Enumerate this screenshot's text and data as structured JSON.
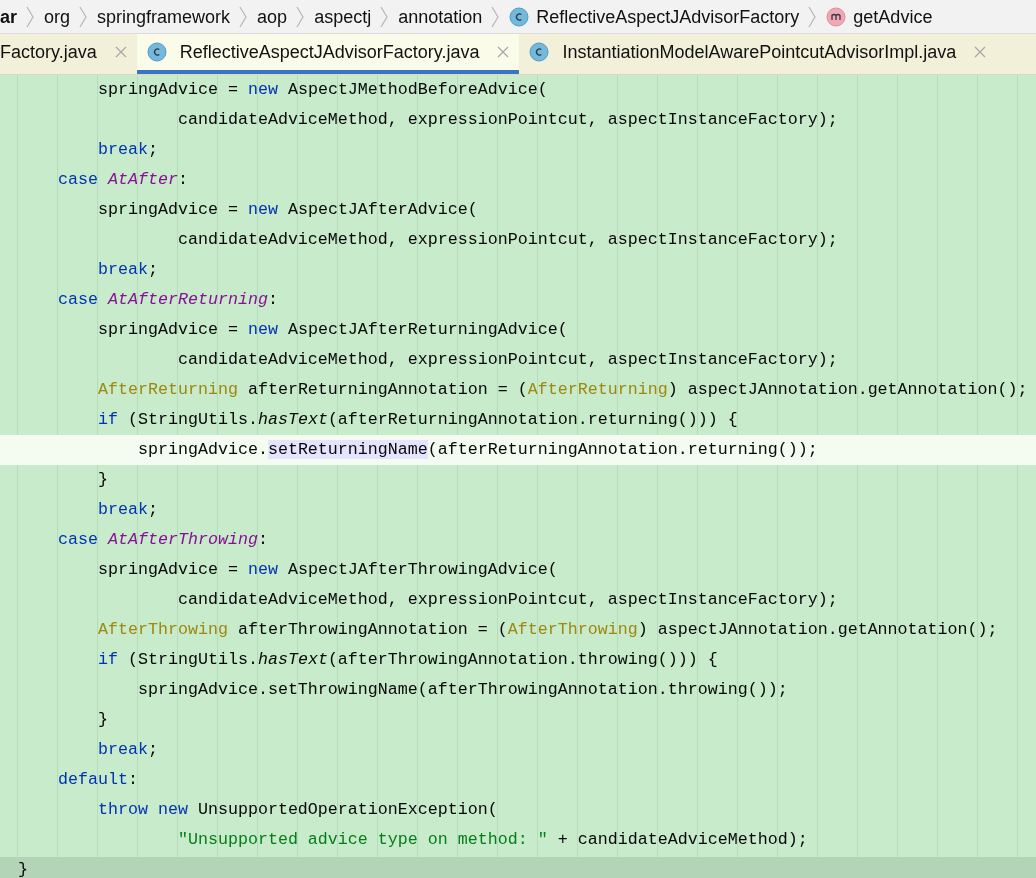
{
  "breadcrumb": [
    {
      "text": "ar",
      "kind": "package",
      "bold": true
    },
    {
      "text": "org",
      "kind": "package",
      "bold": false
    },
    {
      "text": "springframework",
      "kind": "package",
      "bold": false
    },
    {
      "text": "aop",
      "kind": "package",
      "bold": false
    },
    {
      "text": "aspectj",
      "kind": "package",
      "bold": false
    },
    {
      "text": "annotation",
      "kind": "package",
      "bold": false
    },
    {
      "text": "ReflectiveAspectJAdvisorFactory",
      "kind": "class",
      "bold": false
    },
    {
      "text": "getAdvice",
      "kind": "method",
      "bold": false
    }
  ],
  "tabs": [
    {
      "label": "Factory.java",
      "kind": "file",
      "selected": false
    },
    {
      "label": "ReflectiveAspectJAdvisorFactory.java",
      "kind": "class",
      "selected": true
    },
    {
      "label": "InstantiationModelAwarePointcutAdvisorImpl.java",
      "kind": "class",
      "selected": false
    }
  ],
  "code_lines": [
    {
      "current": false,
      "tokens": [
        {
          "kind": "plain",
          "text": "        springAdvice = "
        },
        {
          "kind": "keyword",
          "text": "new"
        },
        {
          "kind": "plain",
          "text": " AspectJMethodBeforeAdvice("
        }
      ]
    },
    {
      "current": false,
      "tokens": [
        {
          "kind": "plain",
          "text": "                candidateAdviceMethod, expressionPointcut, aspectInstanceFactory);"
        }
      ]
    },
    {
      "current": false,
      "tokens": [
        {
          "kind": "keyword",
          "text": "        break"
        },
        {
          "kind": "plain",
          "text": ";"
        }
      ]
    },
    {
      "current": false,
      "tokens": [
        {
          "kind": "keyword",
          "text": "    case"
        },
        {
          "kind": "constant",
          "text": " AtAfter"
        },
        {
          "kind": "plain",
          "text": ":"
        }
      ]
    },
    {
      "current": false,
      "tokens": [
        {
          "kind": "plain",
          "text": "        springAdvice = "
        },
        {
          "kind": "keyword",
          "text": "new"
        },
        {
          "kind": "plain",
          "text": " AspectJAfterAdvice("
        }
      ]
    },
    {
      "current": false,
      "tokens": [
        {
          "kind": "plain",
          "text": "                candidateAdviceMethod, expressionPointcut, aspectInstanceFactory);"
        }
      ]
    },
    {
      "current": false,
      "tokens": [
        {
          "kind": "keyword",
          "text": "        break"
        },
        {
          "kind": "plain",
          "text": ";"
        }
      ]
    },
    {
      "current": false,
      "tokens": [
        {
          "kind": "keyword",
          "text": "    case"
        },
        {
          "kind": "constant",
          "text": " AtAfterReturning"
        },
        {
          "kind": "plain",
          "text": ":"
        }
      ]
    },
    {
      "current": false,
      "tokens": [
        {
          "kind": "plain",
          "text": "        springAdvice = "
        },
        {
          "kind": "keyword",
          "text": "new"
        },
        {
          "kind": "plain",
          "text": " AspectJAfterReturningAdvice("
        }
      ]
    },
    {
      "current": false,
      "tokens": [
        {
          "kind": "plain",
          "text": "                candidateAdviceMethod, expressionPointcut, aspectInstanceFactory);"
        }
      ]
    },
    {
      "current": false,
      "tokens": [
        {
          "kind": "annotation",
          "text": "        AfterReturning"
        },
        {
          "kind": "plain",
          "text": " afterReturningAnnotation = ("
        },
        {
          "kind": "annotation",
          "text": "AfterReturning"
        },
        {
          "kind": "plain",
          "text": ") aspectJAnnotation.getAnnotation();"
        }
      ]
    },
    {
      "current": false,
      "tokens": [
        {
          "kind": "keyword",
          "text": "        if"
        },
        {
          "kind": "plain",
          "text": " (StringUtils."
        },
        {
          "kind": "static",
          "text": "hasText"
        },
        {
          "kind": "plain",
          "text": "(afterReturningAnnotation.returning())) {"
        }
      ]
    },
    {
      "current": true,
      "tokens": [
        {
          "kind": "plain",
          "text": "            springAdvice."
        },
        {
          "kind": "usage",
          "text": "setReturningName"
        },
        {
          "kind": "plain",
          "text": "(afterReturningAnnotation.returning());"
        }
      ]
    },
    {
      "current": false,
      "tokens": [
        {
          "kind": "plain",
          "text": "        }"
        }
      ]
    },
    {
      "current": false,
      "tokens": [
        {
          "kind": "keyword",
          "text": "        break"
        },
        {
          "kind": "plain",
          "text": ";"
        }
      ]
    },
    {
      "current": false,
      "tokens": [
        {
          "kind": "keyword",
          "text": "    case"
        },
        {
          "kind": "constant",
          "text": " AtAfterThrowing"
        },
        {
          "kind": "plain",
          "text": ":"
        }
      ]
    },
    {
      "current": false,
      "tokens": [
        {
          "kind": "plain",
          "text": "        springAdvice = "
        },
        {
          "kind": "keyword",
          "text": "new"
        },
        {
          "kind": "plain",
          "text": " AspectJAfterThrowingAdvice("
        }
      ]
    },
    {
      "current": false,
      "tokens": [
        {
          "kind": "plain",
          "text": "                candidateAdviceMethod, expressionPointcut, aspectInstanceFactory);"
        }
      ]
    },
    {
      "current": false,
      "tokens": [
        {
          "kind": "annotation",
          "text": "        AfterThrowing"
        },
        {
          "kind": "plain",
          "text": " afterThrowingAnnotation = ("
        },
        {
          "kind": "annotation",
          "text": "AfterThrowing"
        },
        {
          "kind": "plain",
          "text": ") aspectJAnnotation.getAnnotation();"
        }
      ]
    },
    {
      "current": false,
      "tokens": [
        {
          "kind": "keyword",
          "text": "        if"
        },
        {
          "kind": "plain",
          "text": " (StringUtils."
        },
        {
          "kind": "static",
          "text": "hasText"
        },
        {
          "kind": "plain",
          "text": "(afterThrowingAnnotation.throwing())) {"
        }
      ]
    },
    {
      "current": false,
      "tokens": [
        {
          "kind": "plain",
          "text": "            springAdvice.setThrowingName(afterThrowingAnnotation.throwing());"
        }
      ]
    },
    {
      "current": false,
      "tokens": [
        {
          "kind": "plain",
          "text": "        }"
        }
      ]
    },
    {
      "current": false,
      "tokens": [
        {
          "kind": "keyword",
          "text": "        break"
        },
        {
          "kind": "plain",
          "text": ";"
        }
      ]
    },
    {
      "current": false,
      "tokens": [
        {
          "kind": "keyword",
          "text": "    default"
        },
        {
          "kind": "plain",
          "text": ":"
        }
      ]
    },
    {
      "current": false,
      "tokens": [
        {
          "kind": "keyword",
          "text": "        throw new"
        },
        {
          "kind": "plain",
          "text": " UnsupportedOperationException("
        }
      ]
    },
    {
      "current": false,
      "tokens": [
        {
          "kind": "string",
          "text": "                \"Unsupported advice type on method: \""
        },
        {
          "kind": "plain",
          "text": " + candidateAdviceMethod);"
        }
      ]
    }
  ],
  "closing_line": {
    "text": "}"
  }
}
